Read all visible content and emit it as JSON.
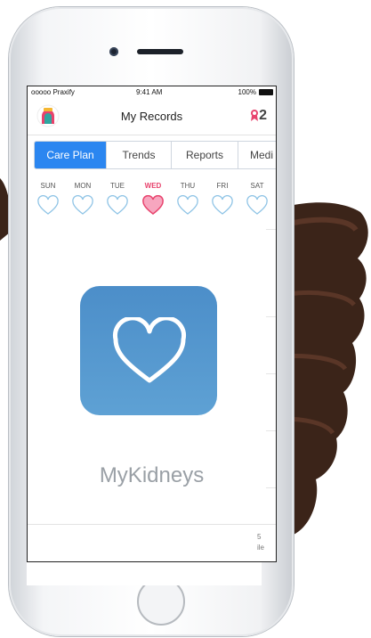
{
  "status_bar": {
    "carrier": "ooooo Praxify",
    "time": "9:41 AM",
    "battery": "100%"
  },
  "header": {
    "title": "My Records",
    "award_count": "2"
  },
  "tabs": [
    {
      "label": "Care Plan",
      "active": true
    },
    {
      "label": "Trends",
      "active": false
    },
    {
      "label": "Reports",
      "active": false
    },
    {
      "label": "Medi",
      "active": false
    }
  ],
  "days": [
    {
      "label": "SUN",
      "active": false
    },
    {
      "label": "MON",
      "active": false
    },
    {
      "label": "TUE",
      "active": false
    },
    {
      "label": "WED",
      "active": true
    },
    {
      "label": "THU",
      "active": false
    },
    {
      "label": "FRI",
      "active": false
    },
    {
      "label": "SAT",
      "active": false
    }
  ],
  "splash": {
    "app_name": "MyKidneys",
    "icon": "heart-outline-icon"
  },
  "partial_text": {
    "line1": "5",
    "line2": "ile"
  },
  "colors": {
    "accent": "#2b86f0",
    "active_day": "#e8436d",
    "splash_bg": "#4f91cb"
  }
}
